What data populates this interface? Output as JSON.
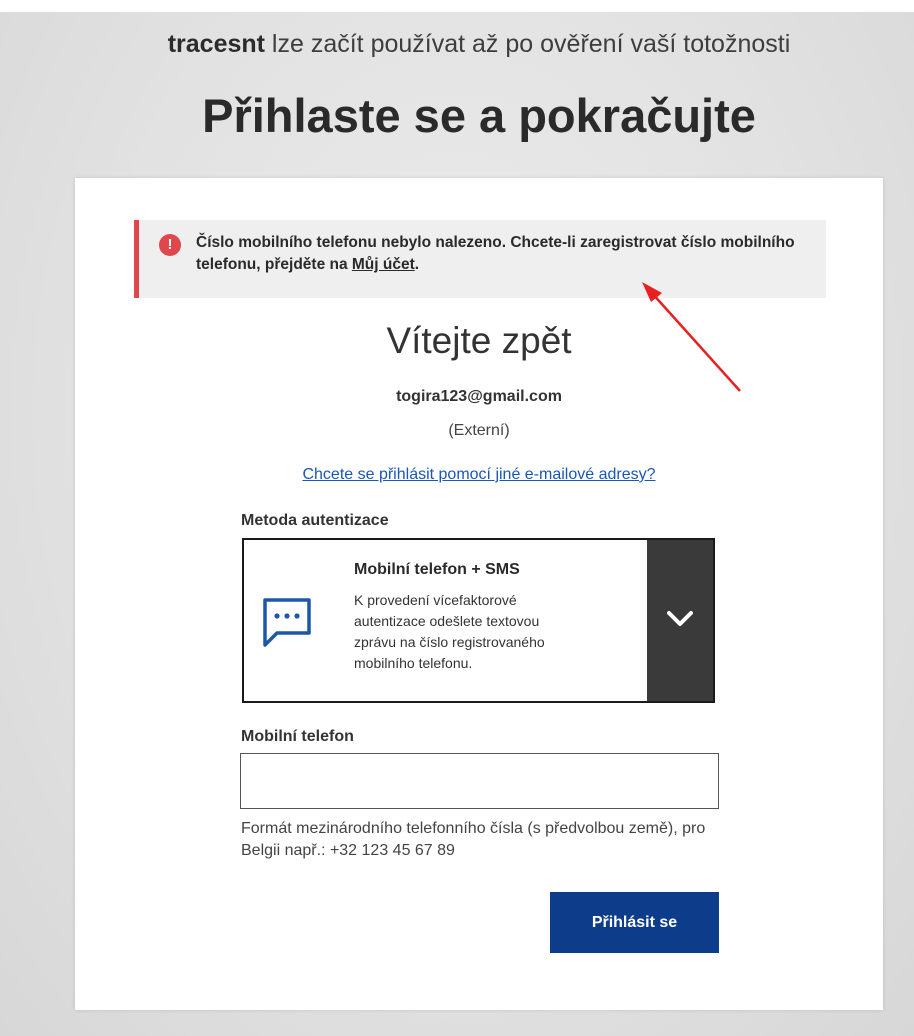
{
  "header": {
    "brand": "tracesnt",
    "subtitle_rest": " lze začít používat až po ověření vaší totožnosti",
    "title": "Přihlaste se a pokračujte"
  },
  "alert": {
    "icon": "exclamation-icon",
    "text": "Číslo mobilního telefonu nebylo nalezeno. Chcete-li zaregistrovat číslo mobilního telefonu, přejděte na ",
    "link_label": "Můj účet",
    "suffix": ".",
    "color": "#e0474c"
  },
  "welcome": {
    "title": "Vítejte zpět",
    "email": "togira123@gmail.com",
    "account_type": "(Externí)",
    "switch_link": "Chcete se přihlásit pomocí jiné e-mailové adresy?"
  },
  "auth_method": {
    "label": "Metoda autentizace",
    "selected_name": "Mobilní telefon + SMS",
    "selected_description": "K provedení vícefaktorové autentizace odešlete textovou zprávu na číslo registrovaného mobilního telefonu.",
    "icon": "sms-icon",
    "dropdown_icon": "chevron-down-icon"
  },
  "phone": {
    "label": "Mobilní telefon",
    "value": "",
    "hint": "Formát mezinárodního telefonního čísla (s předvolbou země), pro Belgii např.: +32 123 45 67 89"
  },
  "submit": {
    "label": "Přihlásit se",
    "color": "#0d3d8a"
  },
  "annotation": {
    "arrow_color": "#e8201f"
  }
}
